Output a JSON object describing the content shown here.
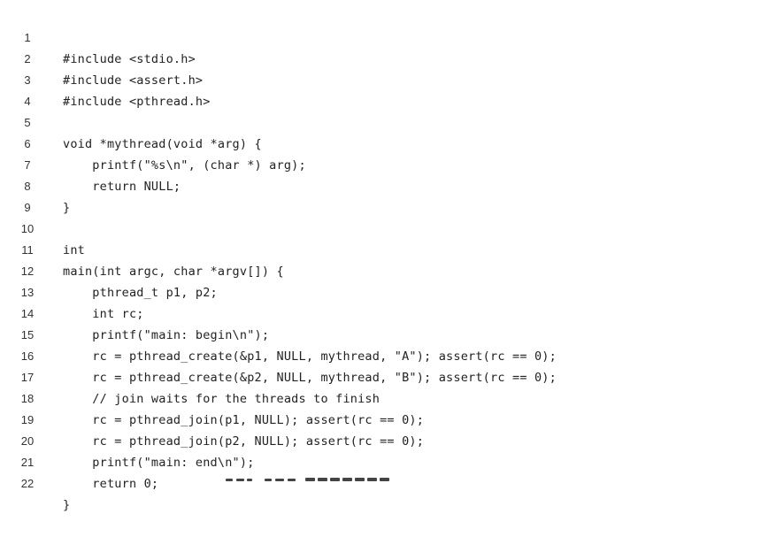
{
  "code": {
    "lines": [
      {
        "number": "1",
        "text": "#include <stdio.h>"
      },
      {
        "number": "2",
        "text": "#include <assert.h>"
      },
      {
        "number": "3",
        "text": "#include <pthread.h>"
      },
      {
        "number": "4",
        "text": ""
      },
      {
        "number": "5",
        "text": "void *mythread(void *arg) {"
      },
      {
        "number": "6",
        "text": "    printf(\"%s\\n\", (char *) arg);"
      },
      {
        "number": "7",
        "text": "    return NULL;"
      },
      {
        "number": "8",
        "text": "}"
      },
      {
        "number": "9",
        "text": ""
      },
      {
        "number": "10",
        "text": "int"
      },
      {
        "number": "11",
        "text": "main(int argc, char *argv[]) {"
      },
      {
        "number": "12",
        "text": "    pthread_t p1, p2;"
      },
      {
        "number": "13",
        "text": "    int rc;"
      },
      {
        "number": "14",
        "text": "    printf(\"main: begin\\n\");"
      },
      {
        "number": "15",
        "text": "    rc = pthread_create(&p1, NULL, mythread, \"A\"); assert(rc == 0);"
      },
      {
        "number": "16",
        "text": "    rc = pthread_create(&p2, NULL, mythread, \"B\"); assert(rc == 0);"
      },
      {
        "number": "17",
        "text": "    // join waits for the threads to finish"
      },
      {
        "number": "18",
        "text": "    rc = pthread_join(p1, NULL); assert(rc == 0);"
      },
      {
        "number": "19",
        "text": "    rc = pthread_join(p2, NULL); assert(rc == 0);"
      },
      {
        "number": "20",
        "text": "    printf(\"main: end\\n\");"
      },
      {
        "number": "21",
        "text": "    return 0;"
      },
      {
        "number": "22",
        "text": "}"
      }
    ]
  }
}
